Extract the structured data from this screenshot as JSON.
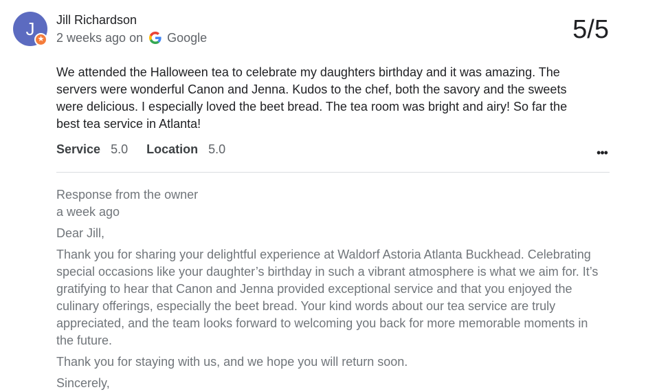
{
  "review": {
    "avatar_letter": "J",
    "reviewer_name": "Jill Richardson",
    "time_ago": "2 weeks ago on",
    "source": "Google",
    "score": "5/5",
    "text": "We attended the Halloween tea to celebrate my daughters birthday and it was amazing. The servers were wonderful Canon and Jenna. Kudos to the chef, both the savory and the sweets were delicious. I especially loved the beet bread. The tea room was bright and airy! So far the best tea service in Atlanta!",
    "ratings": [
      {
        "label": "Service",
        "value": "5.0"
      },
      {
        "label": "Location",
        "value": "5.0"
      }
    ],
    "more_label": "•••",
    "icons": {
      "avatar_badge": "star-badge-icon",
      "source": "google-logo-icon",
      "more": "more-options-icon"
    },
    "colors": {
      "avatar": "#5c6bc0",
      "badge": "#f57c3b"
    }
  },
  "response": {
    "heading": "Response from the owner",
    "time_ago": "a week ago",
    "greeting": "Dear Jill,",
    "body": "Thank you for sharing your delightful experience at Waldorf Astoria Atlanta Buckhead. Celebrating special occasions like your daughter’s birthday in such a vibrant atmosphere is what we aim for. It’s gratifying to hear that Canon and Jenna provided exceptional service and that you enjoyed the culinary offerings, especially the beet bread. Your kind words about our tea service are truly appreciated, and the team looks forward to welcoming you back for more memorable moments in the future.",
    "closing": "Thank you for staying with us, and we hope you will return soon.",
    "signoff": "Sincerely,"
  }
}
